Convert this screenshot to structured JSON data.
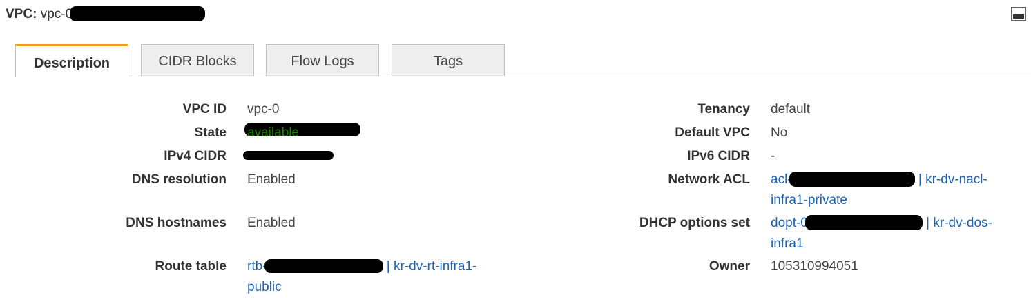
{
  "header": {
    "key": "VPC:",
    "prefix": "vpc-0"
  },
  "tabs": [
    {
      "label": "Description",
      "active": true
    },
    {
      "label": "CIDR Blocks",
      "active": false
    },
    {
      "label": "Flow Logs",
      "active": false
    },
    {
      "label": "Tags",
      "active": false
    }
  ],
  "details": {
    "vpc_id": {
      "label": "VPC ID",
      "prefix": "vpc-0"
    },
    "state": {
      "label": "State",
      "value": "available"
    },
    "ipv4_cidr": {
      "label": "IPv4 CIDR"
    },
    "dns_resolution": {
      "label": "DNS resolution",
      "value": "Enabled"
    },
    "dns_hostnames": {
      "label": "DNS hostnames",
      "value": "Enabled"
    },
    "route_table": {
      "label": "Route table",
      "prefix": "rtb-",
      "name_line1": "| kr-dv-rt-infra1-",
      "name_line2": "public"
    },
    "tenancy": {
      "label": "Tenancy",
      "value": "default"
    },
    "default_vpc": {
      "label": "Default VPC",
      "value": "No"
    },
    "ipv6_cidr": {
      "label": "IPv6 CIDR",
      "value": "-"
    },
    "network_acl": {
      "label": "Network ACL",
      "prefix": "acl-",
      "name_line1": "| kr-dv-nacl-",
      "name_line2": "infra1-private"
    },
    "dhcp_options": {
      "label": "DHCP options set",
      "prefix": "dopt-0",
      "name_line1": "| kr-dv-dos-",
      "name_line2": "infra1"
    },
    "owner": {
      "label": "Owner",
      "value": "105310994051"
    }
  },
  "colors": {
    "accent_tab": "#f39c1d",
    "status_green": "#1d8102",
    "link_blue": "#1e64b4"
  },
  "icons": {
    "minimize": "minimize-icon",
    "resize_grip": "resize-grip-icon"
  }
}
